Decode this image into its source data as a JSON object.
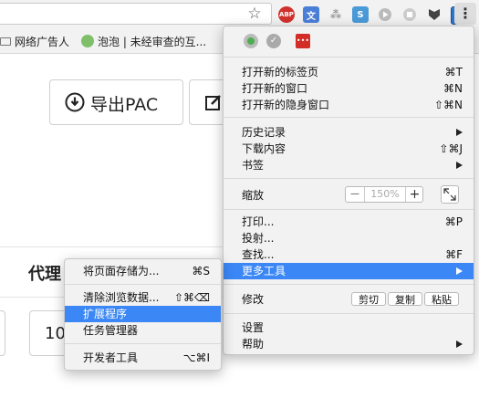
{
  "bookmarks": [
    "网络广告人",
    "泡泡 | 未经审查的互..."
  ],
  "page": {
    "export_pac_label": "导出PAC",
    "proxy_label": "代理",
    "input_value_partial": "10"
  },
  "main_menu": {
    "new_tab": {
      "label": "打开新的标签页",
      "shortcut": "⌘T"
    },
    "new_window": {
      "label": "打开新的窗口",
      "shortcut": "⌘N"
    },
    "new_incognito": {
      "label": "打开新的隐身窗口",
      "shortcut": "⇧⌘N"
    },
    "history": {
      "label": "历史记录"
    },
    "downloads": {
      "label": "下载内容",
      "shortcut": "⇧⌘J"
    },
    "bookmarks": {
      "label": "书签"
    },
    "zoom": {
      "label": "缩放",
      "minus": "—",
      "value": "150%",
      "plus": "+"
    },
    "print": {
      "label": "打印...",
      "shortcut": "⌘P"
    },
    "cast": {
      "label": "投射..."
    },
    "find": {
      "label": "查找...",
      "shortcut": "⌘F"
    },
    "more_tools": {
      "label": "更多工具"
    },
    "edit": {
      "label": "修改",
      "cut": "剪切",
      "copy": "复制",
      "paste": "粘贴"
    },
    "settings": {
      "label": "设置"
    },
    "help": {
      "label": "帮助"
    }
  },
  "sub_menu": {
    "save_as": {
      "label": "将页面存储为...",
      "shortcut": "⌘S"
    },
    "clear_data": {
      "label": "清除浏览数据...",
      "shortcut": "⇧⌘⌫"
    },
    "extensions": {
      "label": "扩展程序"
    },
    "task_manager": {
      "label": "任务管理器"
    },
    "dev_tools": {
      "label": "开发者工具",
      "shortcut": "⌥⌘I"
    }
  },
  "toolbar": {
    "abp_label": "ABP",
    "s_label": "S",
    "more_label": "⋮"
  },
  "colors": {
    "highlight": "#3b87f5",
    "menu_bg": "#f2f2f2",
    "abp_red": "#d0312d"
  }
}
